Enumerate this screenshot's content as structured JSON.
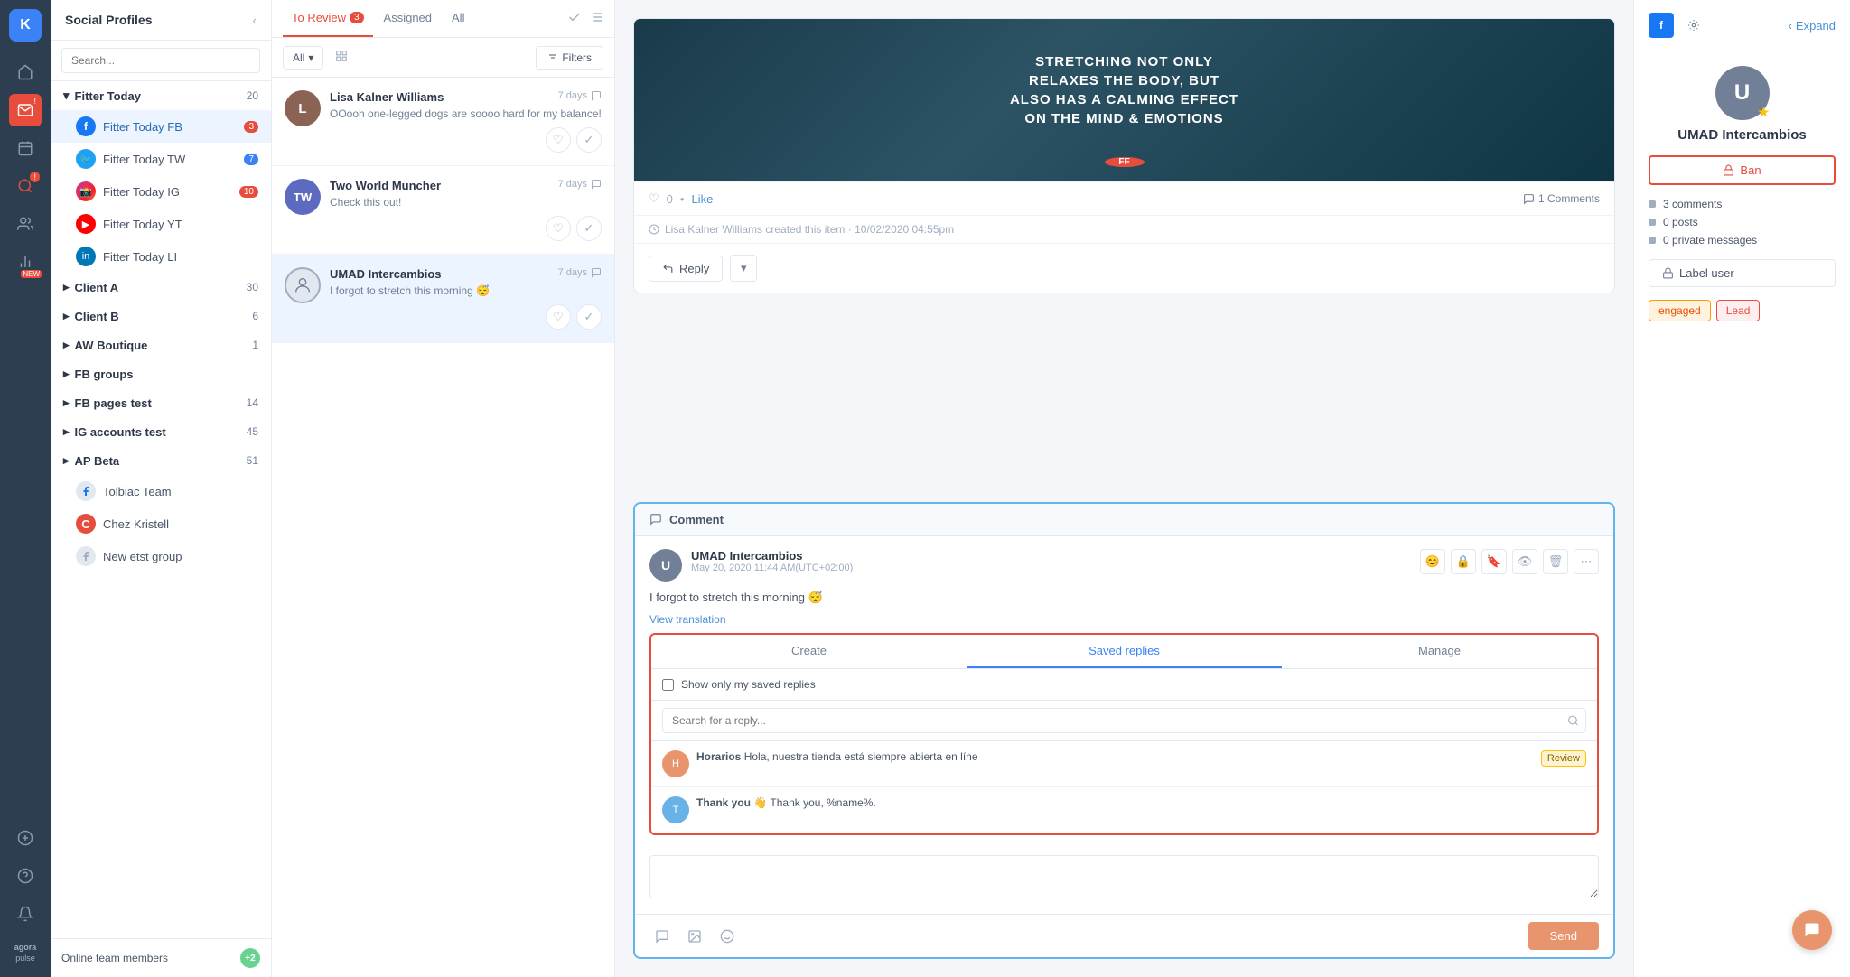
{
  "app": {
    "title": "AgoraPulse"
  },
  "icon_bar": {
    "user_initial": "K",
    "items": [
      "home",
      "inbox",
      "publish",
      "listen",
      "reports",
      "users",
      "analytics"
    ]
  },
  "sidebar": {
    "title": "Social Profiles",
    "search_placeholder": "Search...",
    "groups": [
      {
        "name": "Fitter Today",
        "count": 20,
        "items": [
          {
            "id": "fb",
            "label": "Fitter Today FB",
            "type": "fb",
            "badge": 3,
            "active": true
          },
          {
            "id": "tw",
            "label": "Fitter Today TW",
            "type": "tw",
            "badge": 7,
            "active": false
          },
          {
            "id": "ig",
            "label": "Fitter Today IG",
            "type": "ig",
            "badge": 10,
            "active": false
          },
          {
            "id": "yt",
            "label": "Fitter Today YT",
            "type": "yt",
            "badge": null,
            "active": false
          },
          {
            "id": "li",
            "label": "Fitter Today LI",
            "type": "li",
            "badge": null,
            "active": false
          }
        ]
      },
      {
        "name": "Client A",
        "count": 30,
        "items": []
      },
      {
        "name": "Client B",
        "count": 6,
        "items": []
      },
      {
        "name": "AW Boutique",
        "count": 1,
        "items": []
      },
      {
        "name": "FB groups",
        "count": null,
        "items": []
      },
      {
        "name": "FB pages test",
        "count": 14,
        "items": []
      },
      {
        "name": "IG accounts test",
        "count": 45,
        "items": []
      },
      {
        "name": "AP Beta",
        "count": 51,
        "items": []
      }
    ],
    "standalone": [
      {
        "label": "Tolbiac Team",
        "type": "fb"
      },
      {
        "label": "Chez Kristell",
        "type": "generic",
        "initial": "C"
      },
      {
        "label": "New etst group",
        "type": "fb"
      }
    ],
    "online_label": "Online team members",
    "online_count": "+2"
  },
  "inbox": {
    "tabs": [
      {
        "label": "To Review",
        "badge": 3,
        "active": true
      },
      {
        "label": "Assigned",
        "badge": null,
        "active": false
      },
      {
        "label": "All",
        "badge": null,
        "active": false
      }
    ],
    "filter_label": "All",
    "filter_button": "Filters",
    "items": [
      {
        "id": 1,
        "name": "Lisa Kalner Williams",
        "time": "7 days",
        "text": "OOooh one-legged dogs are soooo hard for my balance!",
        "avatar_color": "#8B4513",
        "selected": false
      },
      {
        "id": 2,
        "name": "Two World Muncher",
        "time": "7 days",
        "text": "Check this out!",
        "avatar_color": "#5c6bc0",
        "selected": false
      },
      {
        "id": 3,
        "name": "UMAD Intercambios",
        "time": "7 days",
        "text": "I forgot to stretch this morning 😴",
        "avatar_color": "#ffffff",
        "selected": true
      }
    ]
  },
  "post": {
    "image_text": "Stretching Not Only Relaxes The Body, But Also Has A Calming Effect On The Mind & Emotions",
    "likes": "0",
    "like_label": "Like",
    "comments_count": "1 Comments",
    "meta_text": "Lisa Kalner Williams created this item · 10/02/2020 04:55pm",
    "reply_button": "Reply"
  },
  "comment": {
    "header_title": "Comment",
    "avatar_initial": "U",
    "user_name": "UMAD Intercambios",
    "time": "May 20, 2020 11:44 AM(UTC+02:00)",
    "text": "I forgot to stretch this morning 😴",
    "translate_label": "View translation",
    "saved_replies": {
      "tabs": [
        "Create",
        "Saved replies",
        "Manage"
      ],
      "active_tab": "Saved replies",
      "filter_label": "Show only my saved replies",
      "search_placeholder": "Search for a reply...",
      "items": [
        {
          "id": 1,
          "name": "Horarios",
          "text": "Hola, nuestra tienda está siempre abierta en líne",
          "label": "Review",
          "avatar_color": "#e8956d"
        },
        {
          "id": 2,
          "name": "Thank you 👋",
          "text": "Thank you, %name%.",
          "label": null,
          "avatar_color": "#68b2e8"
        }
      ]
    },
    "input_placeholder": "",
    "send_button": "Send"
  },
  "right_panel": {
    "expand_label": "Expand",
    "user_name": "UMAD Intercambios",
    "avatar_initial": "U",
    "ban_button": "Ban",
    "stats": [
      {
        "label": "3 comments"
      },
      {
        "label": "0 posts"
      },
      {
        "label": "0 private messages"
      }
    ],
    "label_user_button": "Label user",
    "tags": [
      {
        "label": "engaged",
        "style": "orange"
      },
      {
        "label": "Lead",
        "style": "red"
      }
    ]
  }
}
